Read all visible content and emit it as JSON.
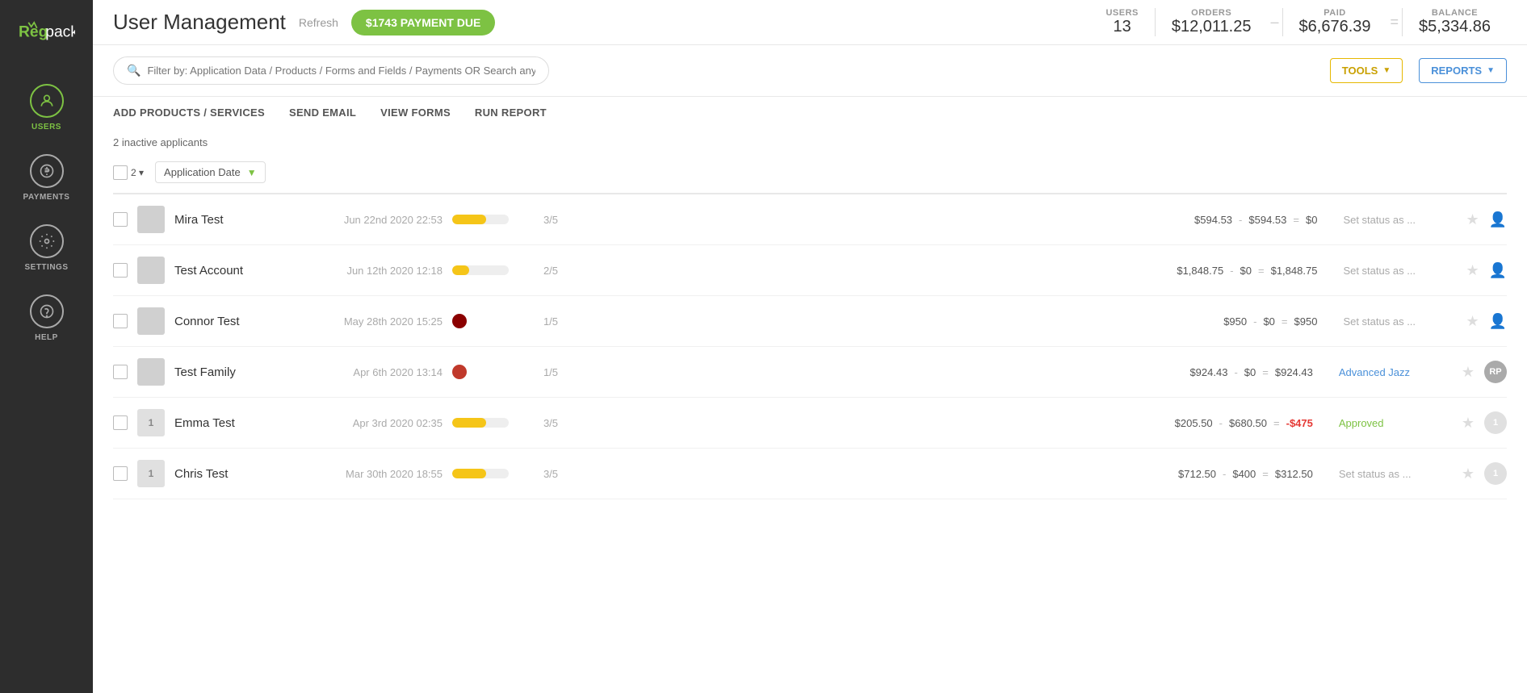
{
  "sidebar": {
    "logo_text": "Regpack",
    "items": [
      {
        "id": "users",
        "label": "USERS",
        "icon": "👤",
        "active": true
      },
      {
        "id": "payments",
        "label": "PAYMENTS",
        "icon": "💰",
        "active": false
      },
      {
        "id": "settings",
        "label": "SETTINGS",
        "icon": "⚙",
        "active": false
      },
      {
        "id": "help",
        "label": "HELP",
        "icon": "?",
        "active": false
      }
    ]
  },
  "header": {
    "title": "User Management",
    "refresh_label": "Refresh",
    "payment_due_label": "$1743 PAYMENT DUE",
    "stats": {
      "users_label": "USERS",
      "users_value": "13",
      "orders_label": "ORDERS",
      "orders_value": "$12,011.25",
      "paid_label": "PAID",
      "paid_value": "$6,676.39",
      "balance_label": "BALANCE",
      "balance_value": "$5,334.86"
    }
  },
  "search": {
    "placeholder": "Filter by: Application Data / Products / Forms and Fields / Payments OR Search anything..."
  },
  "toolbar": {
    "tools_label": "TOOLS",
    "reports_label": "REPORTS"
  },
  "actions": {
    "add_products": "ADD PRODUCTS / SERVICES",
    "send_email": "SEND EMAIL",
    "view_forms": "VIEW FORMS",
    "run_report": "RUN REPORT"
  },
  "table": {
    "inactive_notice": "2 inactive applicants",
    "filter_count": "2",
    "sort_label": "Application Date",
    "columns": [
      "name",
      "date",
      "progress",
      "count",
      "financials",
      "status",
      "actions"
    ],
    "rows": [
      {
        "id": 1,
        "name": "Mira Test",
        "date": "Jun 22nd 2020 22:53",
        "progress_color": "#f5c518",
        "progress_type": "bar",
        "progress_pct": 60,
        "count": "3/5",
        "order": "$594.53",
        "paid": "$594.53",
        "balance": "$0",
        "separator1": "-",
        "separator2": "=",
        "status": "Set status as ...",
        "status_type": "default",
        "avatar_label": "",
        "avatar_bg": "#d0d0d0",
        "badge": null
      },
      {
        "id": 2,
        "name": "Test Account",
        "date": "Jun 12th 2020 12:18",
        "progress_color": "#f5c518",
        "progress_type": "bar",
        "progress_pct": 30,
        "count": "2/5",
        "order": "$1,848.75",
        "paid": "$0",
        "balance": "$1,848.75",
        "separator1": "-",
        "separator2": "=",
        "status": "Set status as ...",
        "status_type": "default",
        "avatar_label": "",
        "avatar_bg": "#d0d0d0",
        "badge": null
      },
      {
        "id": 3,
        "name": "Connor Test",
        "date": "May 28th 2020 15:25",
        "progress_color": "#8b0000",
        "progress_type": "dot",
        "progress_pct": 20,
        "count": "1/5",
        "order": "$950",
        "paid": "$0",
        "balance": "$950",
        "separator1": "-",
        "separator2": "=",
        "status": "Set status as ...",
        "status_type": "default",
        "avatar_label": "",
        "avatar_bg": "#d0d0d0",
        "badge": null
      },
      {
        "id": 4,
        "name": "Test Family",
        "date": "Apr 6th 2020 13:14",
        "progress_color": "#c0392b",
        "progress_type": "dot",
        "progress_pct": 20,
        "count": "1/5",
        "order": "$924.43",
        "paid": "$0",
        "balance": "$924.43",
        "separator1": "-",
        "separator2": "=",
        "status": "Advanced Jazz",
        "status_type": "advanced-jazz",
        "avatar_label": "RP",
        "avatar_bg": "#aaa",
        "badge": "RP"
      },
      {
        "id": 5,
        "name": "Emma Test",
        "date": "Apr 3rd 2020 02:35",
        "progress_color": "#f5c518",
        "progress_type": "bar",
        "progress_pct": 60,
        "count": "3/5",
        "order": "$205.50",
        "paid": "$680.50",
        "balance": "-$475",
        "separator1": "-",
        "separator2": "=",
        "status": "Approved",
        "status_type": "approved",
        "avatar_label": "1",
        "avatar_bg": "#e0e0e0",
        "badge": "1"
      },
      {
        "id": 6,
        "name": "Chris Test",
        "date": "Mar 30th 2020 18:55",
        "progress_color": "#f5c518",
        "progress_type": "bar",
        "progress_pct": 60,
        "count": "3/5",
        "order": "$712.50",
        "paid": "$400",
        "balance": "$312.50",
        "separator1": "-",
        "separator2": "=",
        "status": "Set status as ...",
        "status_type": "default",
        "avatar_label": "1",
        "avatar_bg": "#e0e0e0",
        "badge": "1"
      }
    ]
  }
}
